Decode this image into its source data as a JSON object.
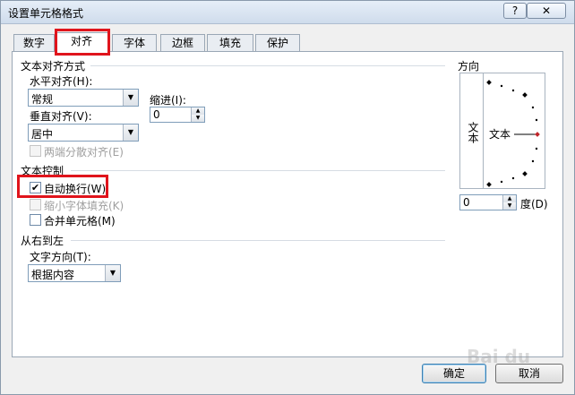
{
  "window": {
    "title": "设置单元格格式",
    "help": "?",
    "close": "✕"
  },
  "tabs": [
    {
      "label": "数字"
    },
    {
      "label": "对齐"
    },
    {
      "label": "字体"
    },
    {
      "label": "边框"
    },
    {
      "label": "填充"
    },
    {
      "label": "保护"
    }
  ],
  "active_tab": "对齐",
  "text_alignment": {
    "group_title": "文本对齐方式",
    "horizontal_label": "水平对齐(H):",
    "horizontal_value": "常规",
    "indent_label": "缩进(I):",
    "indent_value": "0",
    "vertical_label": "垂直对齐(V):",
    "vertical_value": "居中",
    "distributed_label": "两端分散对齐(E)"
  },
  "text_control": {
    "group_title": "文本控制",
    "wrap_label": "自动换行(W)",
    "wrap_checked": true,
    "shrink_label": "缩小字体填充(K)",
    "merge_label": "合并单元格(M)",
    "merge_checked": false
  },
  "rtl": {
    "group_title": "从右到左",
    "direction_label": "文字方向(T):",
    "direction_value": "根据内容"
  },
  "orientation": {
    "group_title": "方向",
    "vertical_text": "文本",
    "dial_text": "文本",
    "degree_value": "0",
    "degree_label": "度(D)"
  },
  "buttons": {
    "ok": "确定",
    "cancel": "取消"
  },
  "colors": {
    "highlight": "#e0141c",
    "marker": "#c0262a"
  }
}
